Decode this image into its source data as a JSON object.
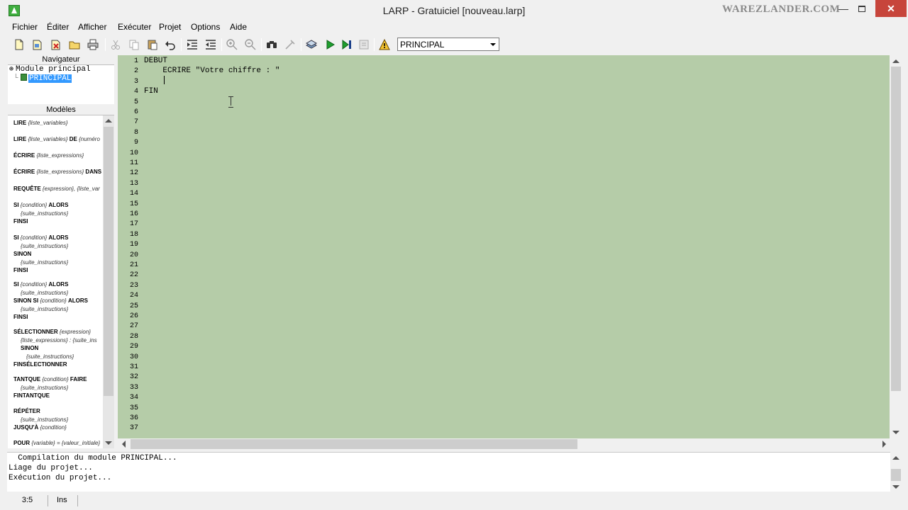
{
  "window": {
    "title": "LARP - Gratuiciel [nouveau.larp]",
    "watermark": "WAREZLANDER.COM",
    "minimize_glyph": "—",
    "close_glyph": "✕"
  },
  "menu": [
    "Fichier",
    "Éditer",
    "Afficher",
    "Exécuter",
    "Projet",
    "Options",
    "Aide"
  ],
  "toolbar": {
    "icons": [
      "new-file-icon",
      "new-module-icon",
      "remove-icon",
      "open-folder-icon",
      "print-icon",
      "cut-icon",
      "copy-icon",
      "paste-icon",
      "undo-icon",
      "indent-icon",
      "outdent-icon",
      "zoom-in-icon",
      "zoom-out-icon",
      "find-icon",
      "replace-icon",
      "compile-icon",
      "run-icon",
      "step-icon",
      "stop-icon",
      "warning-icon"
    ],
    "module_select": "PRINCIPAL"
  },
  "navigator": {
    "header": "Navigateur",
    "root": "Module principal",
    "child": "PRINCIPAL"
  },
  "models": {
    "header": "Modèles",
    "items": [
      [
        "LIRE",
        "{liste_variables}"
      ],
      [
        "LIRE",
        "{liste_variables}",
        "DE",
        "{numéro"
      ],
      [
        "ÉCRIRE",
        "{liste_expressions}"
      ],
      [
        "ÉCRIRE",
        "{liste_expressions}",
        "DANS"
      ],
      [
        "REQUÊTE",
        "{expression}, {liste_var"
      ],
      [
        "SI",
        "{condition}",
        "ALORS",
        "{suite_instructions}",
        "FINSI"
      ],
      [
        "SI",
        "{condition}",
        "ALORS",
        "{suite_instructions}",
        "SINON",
        "{suite_instructions}",
        "FINSI"
      ],
      [
        "SI",
        "{condition}",
        "ALORS",
        "{suite_instructions}",
        "SINON SI",
        "{condition}",
        "ALORS",
        "{suite_instructions}",
        "FINSI"
      ],
      [
        "SÉLECTIONNER",
        "{expression}",
        "{liste_expressions} : {suite_ins",
        "SINON",
        "{suite_instructions}",
        "FINSÉLECTIONNER"
      ],
      [
        "TANTQUE",
        "{condition}",
        "FAIRE",
        "{suite_instructions}",
        "FINTANTQUE"
      ],
      [
        "RÉPÉTER",
        "{suite_instructions}",
        "JUSQU'À",
        "{condition}"
      ],
      [
        "POUR",
        "{variable} = {valeur_initiale}"
      ]
    ]
  },
  "editor": {
    "lines": [
      "DEBUT",
      "    ECRIRE \"Votre chiffre : \"",
      "",
      "FIN"
    ],
    "line_count": 37
  },
  "output": {
    "lines": [
      "  Compilation du module PRINCIPAL...",
      "Liage du projet...",
      "Exécution du projet..."
    ]
  },
  "status": {
    "position": "3:5",
    "mode": "Ins"
  }
}
